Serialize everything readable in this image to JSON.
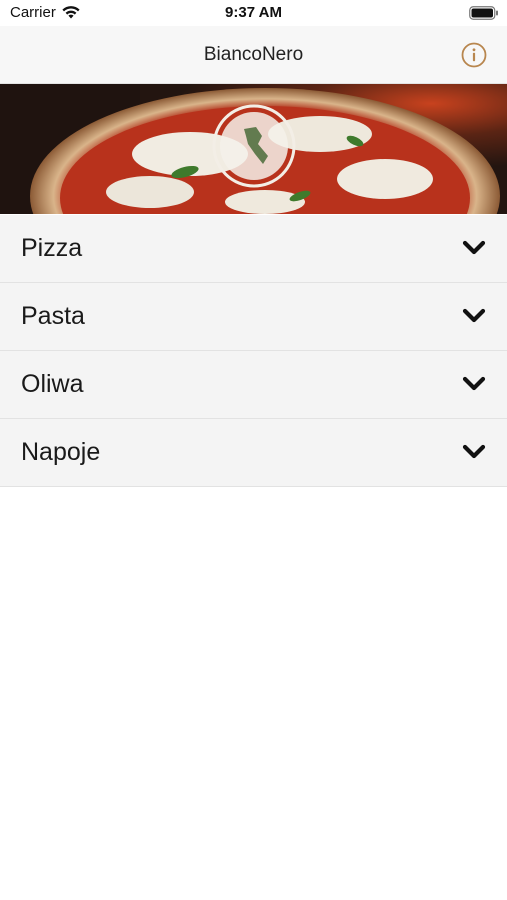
{
  "status_bar": {
    "carrier": "Carrier",
    "time": "9:37 AM"
  },
  "nav": {
    "title": "BiancoNero",
    "info_icon": "info-circle-icon"
  },
  "colors": {
    "accent": "#b8864e",
    "row_background": "#f4f4f4",
    "divider": "#e2e2e2"
  },
  "categories": [
    {
      "label": "Pizza",
      "icon": "chevron-down-icon"
    },
    {
      "label": "Pasta",
      "icon": "chevron-down-icon"
    },
    {
      "label": "Oliwa",
      "icon": "chevron-down-icon"
    },
    {
      "label": "Napoje",
      "icon": "chevron-down-icon"
    }
  ]
}
